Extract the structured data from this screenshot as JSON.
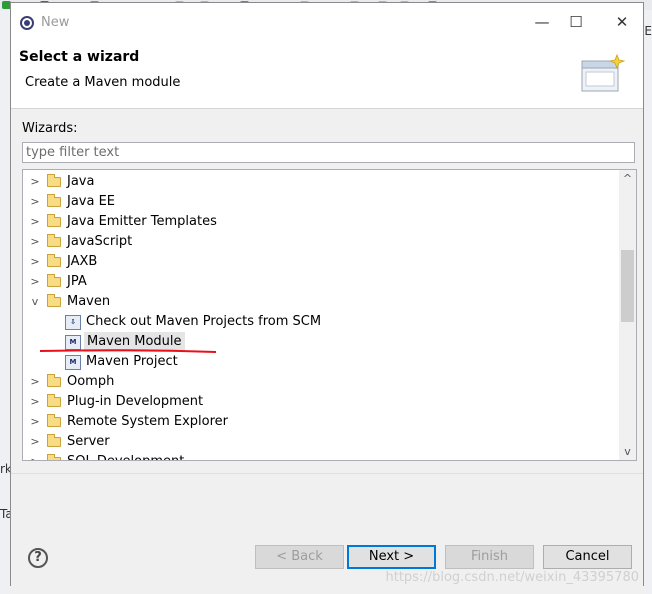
{
  "window": {
    "title": "New",
    "min_glyph": "—",
    "max_glyph": "☐",
    "close_glyph": "✕"
  },
  "header": {
    "title": "Select a wizard",
    "description": "Create a Maven module"
  },
  "filter": {
    "label": "Wizards:",
    "placeholder": "type filter text"
  },
  "tree": {
    "items": [
      {
        "label": "Java"
      },
      {
        "label": "Java EE"
      },
      {
        "label": "Java Emitter Templates"
      },
      {
        "label": "JavaScript"
      },
      {
        "label": "JAXB"
      },
      {
        "label": "JPA"
      },
      {
        "label": "Maven"
      },
      {
        "label": "Check out Maven Projects from SCM"
      },
      {
        "label": "Maven Module"
      },
      {
        "label": "Maven Project"
      },
      {
        "label": "Oomph"
      },
      {
        "label": "Plug-in Development"
      },
      {
        "label": "Remote System Explorer"
      },
      {
        "label": "Server"
      },
      {
        "label": "SQL Development"
      }
    ]
  },
  "buttons": {
    "help": "?",
    "back": "< Back",
    "next": "Next >",
    "finish": "Finish",
    "cancel": "Cancel"
  },
  "background": {
    "left_fragment_1": "rk",
    "left_fragment_2": "Ta",
    "right_fragment": "E"
  },
  "watermark": "https://blog.csdn.net/weixin_43395780",
  "colors": {
    "annotation_red": "#e8111b",
    "default_button_border": "#0078d7"
  }
}
